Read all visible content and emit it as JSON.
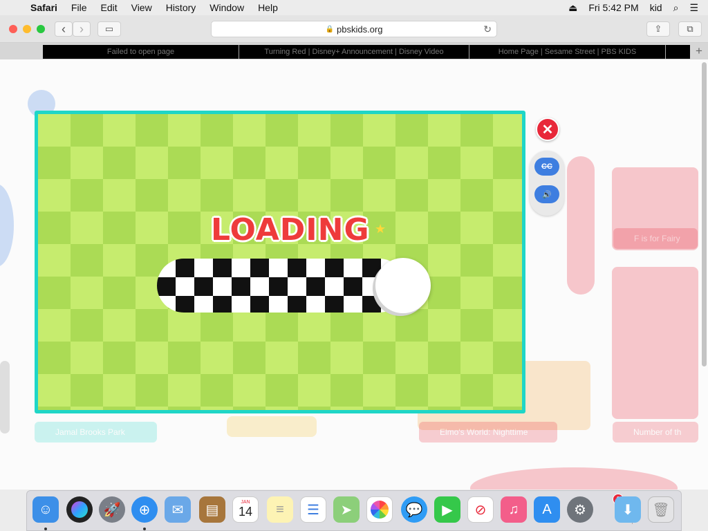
{
  "menubar": {
    "apple_icon": "apple-icon",
    "app_name": "Safari",
    "items": [
      "File",
      "Edit",
      "View",
      "History",
      "Window",
      "Help"
    ],
    "clock": "Fri 5:42 PM",
    "user": "kid"
  },
  "toolbar": {
    "back_glyph": "‹",
    "forward_glyph": "›",
    "sidebar_glyph": "▭",
    "url": "pbskids.org",
    "lock_glyph": "🔒",
    "reload_glyph": "↻",
    "share_glyph": "⇪",
    "tabs_glyph": "⧉"
  },
  "tabs": [
    {
      "title": "Failed to open page"
    },
    {
      "title": "Turning Red | Disney+ Announcement | Disney Video"
    },
    {
      "title": "Home Page | Sesame Street | PBS KIDS"
    }
  ],
  "tab_add": "+",
  "background_labels": [
    "Jamal Brooks Park",
    "Elmo's World: Nighttime",
    "Number of th"
  ],
  "game": {
    "loading_text": "LOADING",
    "progress_fraction": 1.0,
    "close_glyph": "✕",
    "cc_label": "CC",
    "sound_glyph": "🔊"
  },
  "dock": {
    "items": [
      "Finder",
      "Siri",
      "Launchpad",
      "Safari",
      "Mail",
      "Contacts",
      "Calendar",
      "Notes",
      "Reminders",
      "Maps",
      "Photos",
      "Messages",
      "FaceTime",
      "News",
      "Music",
      "App Store",
      "System Preferences",
      "Downloads",
      "Trash"
    ],
    "calendar_month": "JAN",
    "calendar_day": "14",
    "prefs_badge": "1"
  },
  "colors": {
    "game_border": "#1fd6c7",
    "checker_light": "#c6ec6e",
    "checker_dark": "#abdb55",
    "loading_red": "#ee3b3b",
    "close_red": "#e8283a",
    "control_blue": "#3e7ee0"
  }
}
